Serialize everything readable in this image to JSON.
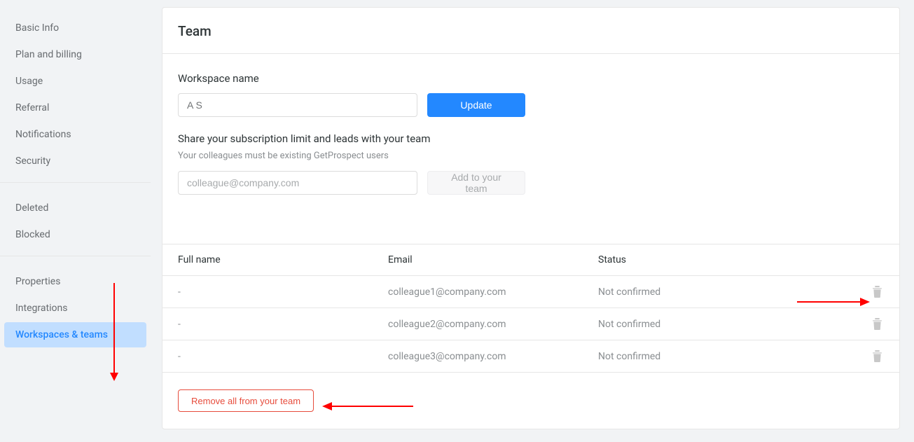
{
  "sidebar": {
    "group1": [
      {
        "label": "Basic Info"
      },
      {
        "label": "Plan and billing"
      },
      {
        "label": "Usage"
      },
      {
        "label": "Referral"
      },
      {
        "label": "Notifications"
      },
      {
        "label": "Security"
      }
    ],
    "group2": [
      {
        "label": "Deleted"
      },
      {
        "label": "Blocked"
      }
    ],
    "group3": [
      {
        "label": "Properties"
      },
      {
        "label": "Integrations"
      },
      {
        "label": "Workspaces & teams",
        "active": true
      }
    ]
  },
  "page": {
    "title": "Team",
    "workspace_name_label": "Workspace name",
    "workspace_name_value": "A S",
    "update_button": "Update",
    "share_heading": "Share your subscription limit and leads with your team",
    "share_hint": "Your colleagues must be existing GetProspect users",
    "add_email_placeholder": "colleague@company.com",
    "add_button": "Add to your team",
    "remove_all": "Remove all from your team"
  },
  "table": {
    "headers": {
      "name": "Full name",
      "email": "Email",
      "status": "Status"
    },
    "rows": [
      {
        "name": "-",
        "email": "colleague1@company.com",
        "status": "Not confirmed"
      },
      {
        "name": "-",
        "email": "colleague2@company.com",
        "status": "Not confirmed"
      },
      {
        "name": "-",
        "email": "colleague3@company.com",
        "status": "Not confirmed"
      }
    ]
  }
}
